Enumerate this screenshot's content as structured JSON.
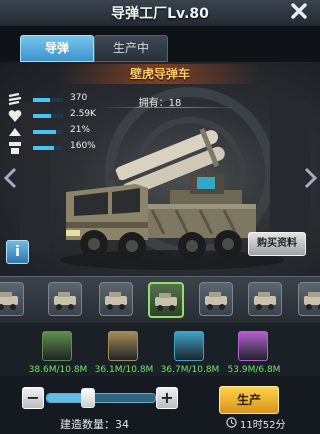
{
  "header": {
    "title": "导弹工厂Lv.80"
  },
  "tabs": [
    {
      "label": "导弹",
      "active": true
    },
    {
      "label": "生产中",
      "active": false
    }
  ],
  "unit": {
    "name": "壁虎导弹车",
    "owned_label": "拥有：18",
    "stats": [
      {
        "icon": "attack-icon",
        "value": "370",
        "fill": 0.55
      },
      {
        "icon": "health-icon",
        "value": "2.59K",
        "fill": 0.6
      },
      {
        "icon": "dodge-icon",
        "value": "21%",
        "fill": 0.75
      },
      {
        "icon": "armor-icon",
        "value": "160%",
        "fill": 0.7
      }
    ],
    "buy_label": "购买资料"
  },
  "units_strip": {
    "items": [
      {
        "name": "unit-thumb-partial",
        "selected": false
      },
      {
        "name": "unit-thumb-1",
        "selected": false
      },
      {
        "name": "unit-thumb-2",
        "selected": false
      },
      {
        "name": "unit-thumb-3",
        "selected": true
      },
      {
        "name": "unit-thumb-4",
        "selected": false
      },
      {
        "name": "unit-thumb-5",
        "selected": false
      },
      {
        "name": "unit-thumb-6",
        "selected": false
      }
    ]
  },
  "resources": [
    {
      "icon": "ore-icon",
      "value": "38.6M/10.8M",
      "color": "#5f8f4b"
    },
    {
      "icon": "fuel-icon",
      "value": "36.1M/10.8M",
      "color": "#a78c56"
    },
    {
      "icon": "crystal-icon",
      "value": "36.7M/10.8M",
      "color": "#3ea3c9"
    },
    {
      "icon": "gem-icon",
      "value": "53.9M/6.8M",
      "color": "#b55fd0"
    }
  ],
  "production": {
    "minus_label": "−",
    "plus_label": "+",
    "slider_fraction": 0.37,
    "quantity_label": "建造数量：34",
    "produce_label": "生产",
    "time_label": "11时52分"
  }
}
